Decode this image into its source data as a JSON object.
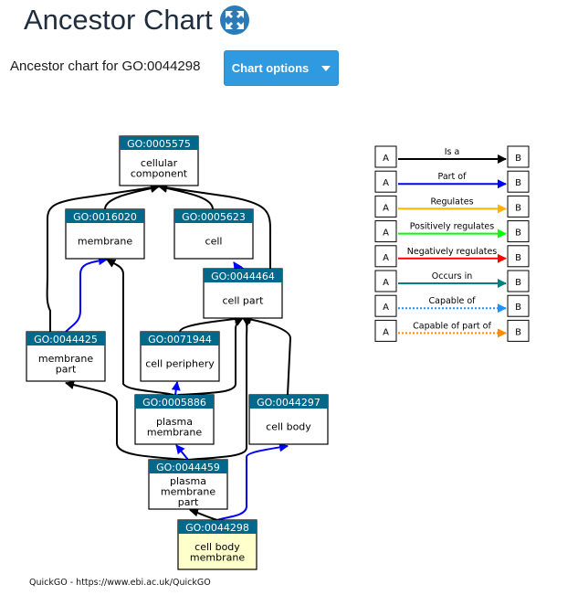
{
  "header": {
    "title": "Ancestor Chart",
    "expand_icon": "expand-arrows-icon",
    "subtitle": "Ancestor chart for GO:0044298",
    "chart_options_label": "Chart options"
  },
  "colors": {
    "node_header": "#00688b",
    "node_header_text": "#ffffff",
    "highlight_node_fill": "#ffffcc",
    "button": "#2f9ae0",
    "is_a": "#000000",
    "part_of": "#0000ff",
    "regulates": "#ffb300",
    "positively_regulates": "#00ff00",
    "negatively_regulates": "#ff0000",
    "occurs_in": "#008080",
    "capable_of": "#1e90ff",
    "capable_of_part_of": "#ff8c00"
  },
  "graph": {
    "nodes": [
      {
        "id": "GO:0005575",
        "label": [
          "cellular",
          "component"
        ],
        "highlight": false
      },
      {
        "id": "GO:0016020",
        "label": [
          "membrane"
        ],
        "highlight": false
      },
      {
        "id": "GO:0005623",
        "label": [
          "cell"
        ],
        "highlight": false
      },
      {
        "id": "GO:0044464",
        "label": [
          "cell part"
        ],
        "highlight": false
      },
      {
        "id": "GO:0044425",
        "label": [
          "membrane",
          "part"
        ],
        "highlight": false
      },
      {
        "id": "GO:0071944",
        "label": [
          "cell periphery"
        ],
        "highlight": false
      },
      {
        "id": "GO:0005886",
        "label": [
          "plasma",
          "membrane"
        ],
        "highlight": false
      },
      {
        "id": "GO:0044297",
        "label": [
          "cell body"
        ],
        "highlight": false
      },
      {
        "id": "GO:0044459",
        "label": [
          "plasma",
          "membrane",
          "part"
        ],
        "highlight": false
      },
      {
        "id": "GO:0044298",
        "label": [
          "cell body",
          "membrane"
        ],
        "highlight": true
      }
    ],
    "edges": [
      {
        "from": "GO:0016020",
        "to": "GO:0005575",
        "relation": "is_a"
      },
      {
        "from": "GO:0005623",
        "to": "GO:0005575",
        "relation": "is_a"
      },
      {
        "from": "GO:0044425",
        "to": "GO:0005575",
        "relation": "is_a"
      },
      {
        "from": "GO:0044464",
        "to": "GO:0005575",
        "relation": "is_a"
      },
      {
        "from": "GO:0044464",
        "to": "GO:0005623",
        "relation": "part_of"
      },
      {
        "from": "GO:0044425",
        "to": "GO:0016020",
        "relation": "part_of"
      },
      {
        "from": "GO:0005886",
        "to": "GO:0016020",
        "relation": "is_a"
      },
      {
        "from": "GO:0071944",
        "to": "GO:0044464",
        "relation": "is_a"
      },
      {
        "from": "GO:0005886",
        "to": "GO:0044464",
        "relation": "is_a"
      },
      {
        "from": "GO:0005886",
        "to": "GO:0071944",
        "relation": "part_of"
      },
      {
        "from": "GO:0044459",
        "to": "GO:0044464",
        "relation": "is_a"
      },
      {
        "from": "GO:0044297",
        "to": "GO:0044464",
        "relation": "is_a"
      },
      {
        "from": "GO:0044459",
        "to": "GO:0044425",
        "relation": "is_a"
      },
      {
        "from": "GO:0044459",
        "to": "GO:0005886",
        "relation": "part_of"
      },
      {
        "from": "GO:0044298",
        "to": "GO:0044459",
        "relation": "is_a"
      },
      {
        "from": "GO:0044298",
        "to": "GO:0044297",
        "relation": "part_of"
      }
    ]
  },
  "legend": {
    "items": [
      {
        "relation": "is_a",
        "label": "Is a",
        "from": "A",
        "to": "B",
        "dashed": false
      },
      {
        "relation": "part_of",
        "label": "Part of",
        "from": "A",
        "to": "B",
        "dashed": false
      },
      {
        "relation": "regulates",
        "label": "Regulates",
        "from": "A",
        "to": "B",
        "dashed": false
      },
      {
        "relation": "positively_regulates",
        "label": "Positively regulates",
        "from": "A",
        "to": "B",
        "dashed": false
      },
      {
        "relation": "negatively_regulates",
        "label": "Negatively regulates",
        "from": "A",
        "to": "B",
        "dashed": false
      },
      {
        "relation": "occurs_in",
        "label": "Occurs in",
        "from": "A",
        "to": "B",
        "dashed": false
      },
      {
        "relation": "capable_of",
        "label": "Capable of",
        "from": "A",
        "to": "B",
        "dashed": true
      },
      {
        "relation": "capable_of_part_of",
        "label": "Capable of part of",
        "from": "A",
        "to": "B",
        "dashed": true
      }
    ]
  },
  "footer": {
    "credit": "QuickGO - https://www.ebi.ac.uk/QuickGO"
  }
}
